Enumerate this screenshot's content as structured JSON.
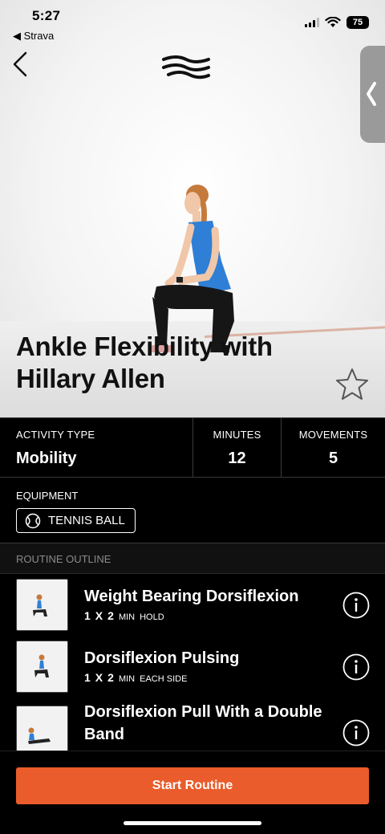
{
  "status_bar": {
    "time": "5:27",
    "back_app": "◀ Strava",
    "battery": "75"
  },
  "header": {
    "back_icon": "chevron-left-icon",
    "logo_icon": "brand-wave-logo",
    "side_panel_icon": "chevron-left-icon"
  },
  "workout": {
    "title": "Ankle Flexibility with Hillary Allen",
    "favorite_icon": "star-outline-icon"
  },
  "stats": {
    "activity_type_label": "ACTIVITY TYPE",
    "activity_type_value": "Mobility",
    "minutes_label": "MINUTES",
    "minutes_value": "12",
    "movements_label": "MOVEMENTS",
    "movements_value": "5"
  },
  "equipment": {
    "label": "EQUIPMENT",
    "items": [
      {
        "name": "TENNIS BALL",
        "icon": "tennis-ball-icon"
      }
    ]
  },
  "routine": {
    "header": "ROUTINE OUTLINE",
    "items": [
      {
        "name": "Weight Bearing Dorsiflexion",
        "sets": "1",
        "x": "X",
        "reps": "2",
        "unit": "MIN",
        "note": "HOLD"
      },
      {
        "name": "Dorsiflexion Pulsing",
        "sets": "1",
        "x": "X",
        "reps": "2",
        "unit": "MIN",
        "note": "EACH SIDE"
      },
      {
        "name": "Dorsiflexion Pull With a Double Band",
        "sets": "",
        "x": "",
        "reps": "",
        "unit": "",
        "note": ""
      }
    ]
  },
  "cta": {
    "label": "Start Routine"
  },
  "colors": {
    "accent": "#ea5c2b",
    "background": "#000000",
    "divider": "#3a3a3a"
  }
}
